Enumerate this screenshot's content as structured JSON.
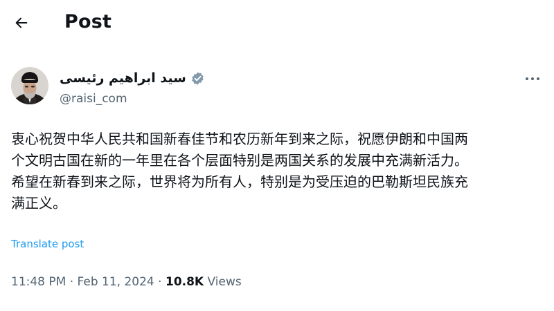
{
  "header": {
    "title": "Post"
  },
  "author": {
    "name": "سید ابراهیم رئیسی",
    "handle": "@raisi_com"
  },
  "post": {
    "lines": [
      "衷心祝贺中华人民共和国新春佳节和农历新年到来之际，祝愿伊朗和中国两",
      "个文明古国在新的一年里在各个层面特别是两国关系的发展中充满新活力。",
      "希望在新春到来之际，世界将为所有人，特别是为受压迫的巴勒斯坦民族充",
      "满正义。"
    ],
    "translate_label": "Translate post"
  },
  "meta": {
    "time": "11:48 PM",
    "date": "Feb 11, 2024",
    "separator": "·",
    "views_count": "10.8K",
    "views_label": "Views"
  },
  "colors": {
    "text": "#0f1419",
    "secondary": "#536471",
    "link": "#1d9bf0",
    "verified_badge": "#829aab"
  },
  "icons": {
    "back": "arrow-left-icon",
    "verified": "verified-badge-icon",
    "more": "more-horizontal-icon"
  }
}
